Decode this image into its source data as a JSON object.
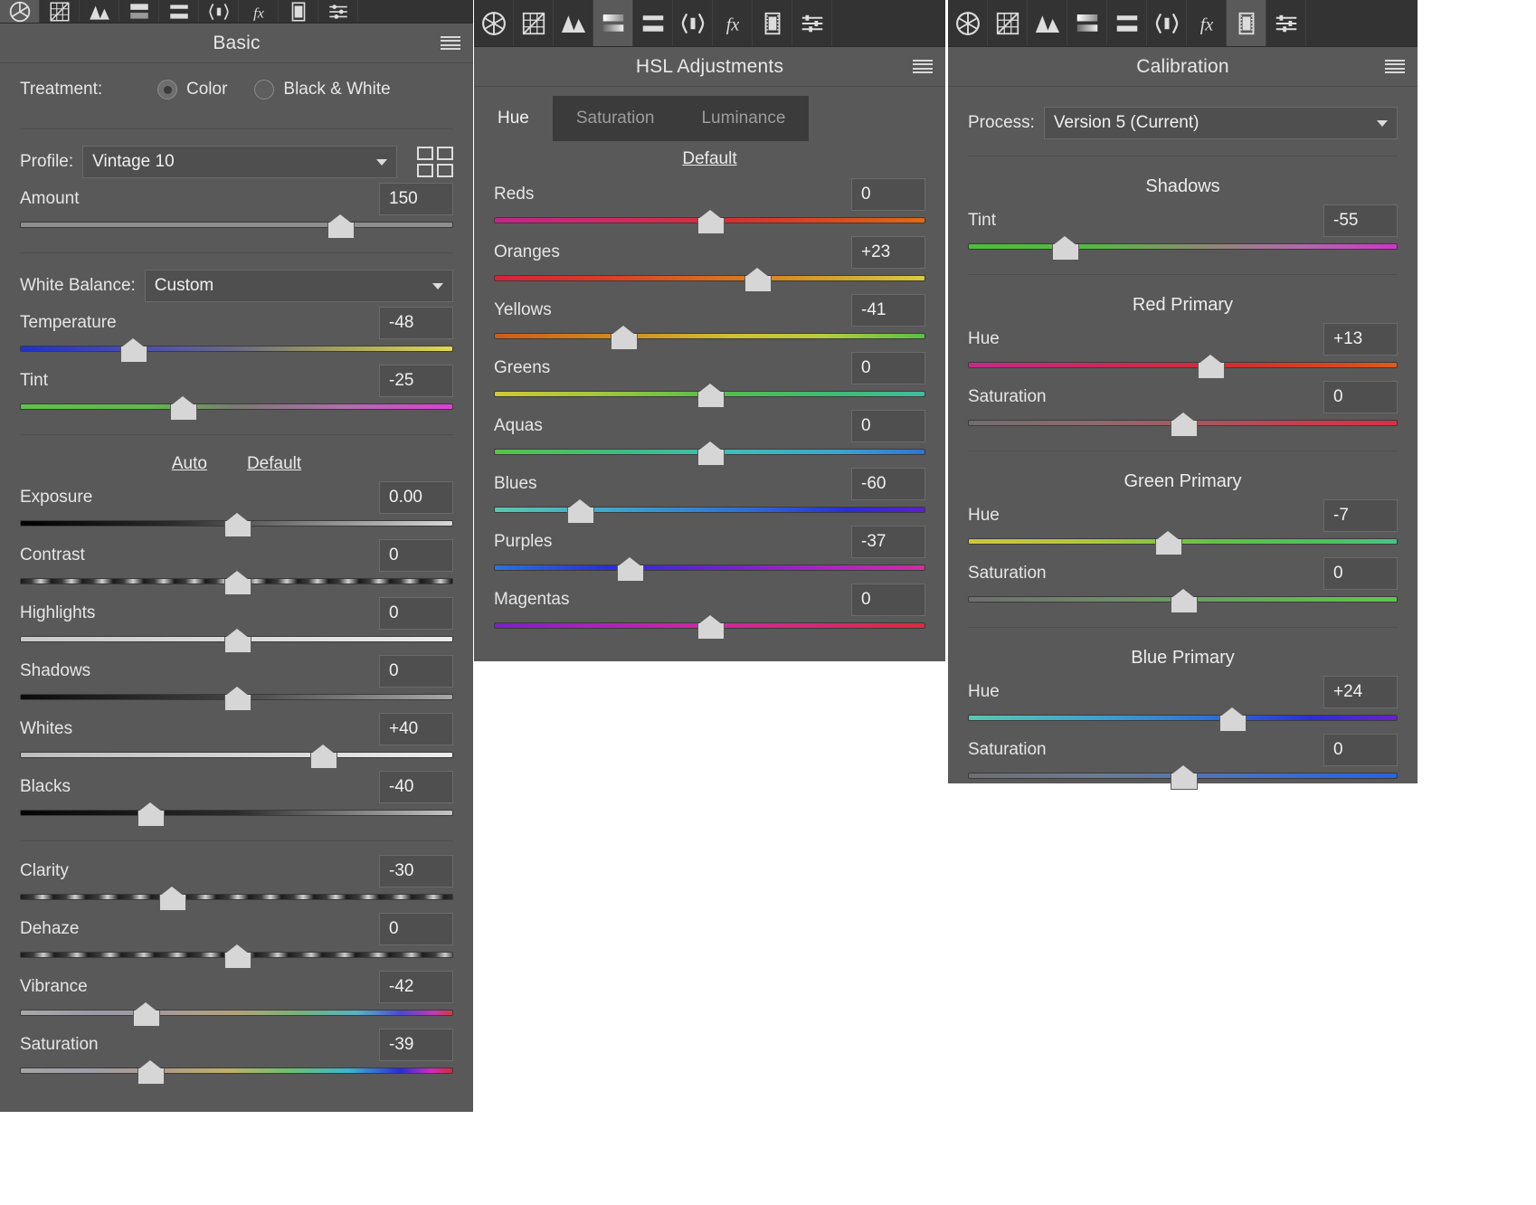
{
  "basic": {
    "title": "Basic",
    "menu_icon": "hamburger-icon",
    "toolbar_icons": [
      "aperture-icon",
      "tone-curve-icon",
      "detail-icon",
      "hsl-icon",
      "split-tone-icon",
      "lens-correction-icon",
      "effects-fx-icon",
      "calibration-icon",
      "presets-icon"
    ],
    "treatment": {
      "label": "Treatment:",
      "color_label": "Color",
      "bw_label": "Black & White",
      "selected": "Color"
    },
    "profile": {
      "label": "Profile:",
      "value": "Vintage 10"
    },
    "amount": {
      "label": "Amount",
      "value": "150",
      "pos": 74
    },
    "white_balance": {
      "label": "White Balance:",
      "value": "Custom"
    },
    "temperature": {
      "label": "Temperature",
      "value": "-48",
      "pos": 26
    },
    "tint": {
      "label": "Tint",
      "value": "-25",
      "pos": 37.5
    },
    "auto_label": "Auto",
    "default_label": "Default",
    "tone": [
      {
        "label": "Exposure",
        "value": "0.00",
        "pos": 50
      },
      {
        "label": "Contrast",
        "value": "0",
        "pos": 50
      },
      {
        "label": "Highlights",
        "value": "0",
        "pos": 50
      },
      {
        "label": "Shadows",
        "value": "0",
        "pos": 50
      },
      {
        "label": "Whites",
        "value": "+40",
        "pos": 70
      },
      {
        "label": "Blacks",
        "value": "-40",
        "pos": 30
      }
    ],
    "presence": [
      {
        "label": "Clarity",
        "value": "-30",
        "pos": 35
      },
      {
        "label": "Dehaze",
        "value": "0",
        "pos": 50
      },
      {
        "label": "Vibrance",
        "value": "-42",
        "pos": 29
      },
      {
        "label": "Saturation",
        "value": "-39",
        "pos": 30
      }
    ]
  },
  "hsl": {
    "title": "HSL Adjustments",
    "menu_icon": "hamburger-icon",
    "toolbar_icons": [
      "aperture-icon",
      "tone-curve-icon",
      "detail-icon",
      "hsl-icon",
      "split-tone-icon",
      "lens-correction-icon",
      "effects-fx-icon",
      "calibration-icon",
      "presets-icon"
    ],
    "tabs": [
      {
        "label": "Hue",
        "active": true
      },
      {
        "label": "Saturation",
        "active": false
      },
      {
        "label": "Luminance",
        "active": false
      }
    ],
    "default_label": "Default",
    "sliders": [
      {
        "label": "Reds",
        "value": "0",
        "pos": 50
      },
      {
        "label": "Oranges",
        "value": "+23",
        "pos": 61
      },
      {
        "label": "Yellows",
        "value": "-41",
        "pos": 30
      },
      {
        "label": "Greens",
        "value": "0",
        "pos": 50
      },
      {
        "label": "Aquas",
        "value": "0",
        "pos": 50
      },
      {
        "label": "Blues",
        "value": "-60",
        "pos": 20
      },
      {
        "label": "Purples",
        "value": "-37",
        "pos": 31.5
      },
      {
        "label": "Magentas",
        "value": "0",
        "pos": 50
      }
    ]
  },
  "calibration": {
    "title": "Calibration",
    "menu_icon": "hamburger-icon",
    "toolbar_icons": [
      "aperture-icon",
      "tone-curve-icon",
      "detail-icon",
      "hsl-icon",
      "split-tone-icon",
      "lens-correction-icon",
      "effects-fx-icon",
      "calibration-icon",
      "presets-icon"
    ],
    "process": {
      "label": "Process:",
      "value": "Version 5 (Current)"
    },
    "groups": [
      {
        "title": "Shadows",
        "sliders": [
          {
            "label": "Tint",
            "value": "-55",
            "pos": 22.5
          }
        ]
      },
      {
        "title": "Red Primary",
        "sliders": [
          {
            "label": "Hue",
            "value": "+13",
            "pos": 56.5
          },
          {
            "label": "Saturation",
            "value": "0",
            "pos": 50
          }
        ]
      },
      {
        "title": "Green Primary",
        "sliders": [
          {
            "label": "Hue",
            "value": "-7",
            "pos": 46.5
          },
          {
            "label": "Saturation",
            "value": "0",
            "pos": 50
          }
        ]
      },
      {
        "title": "Blue Primary",
        "sliders": [
          {
            "label": "Hue",
            "value": "+24",
            "pos": 61.5
          },
          {
            "label": "Saturation",
            "value": "0",
            "pos": 50
          }
        ]
      }
    ]
  },
  "colors": {
    "panel_bg": "#595959",
    "toolbar_bg": "#333333",
    "field_bg": "#4f4f4f",
    "text": "#e8e8e8",
    "thumb": "#d6d6d6"
  }
}
